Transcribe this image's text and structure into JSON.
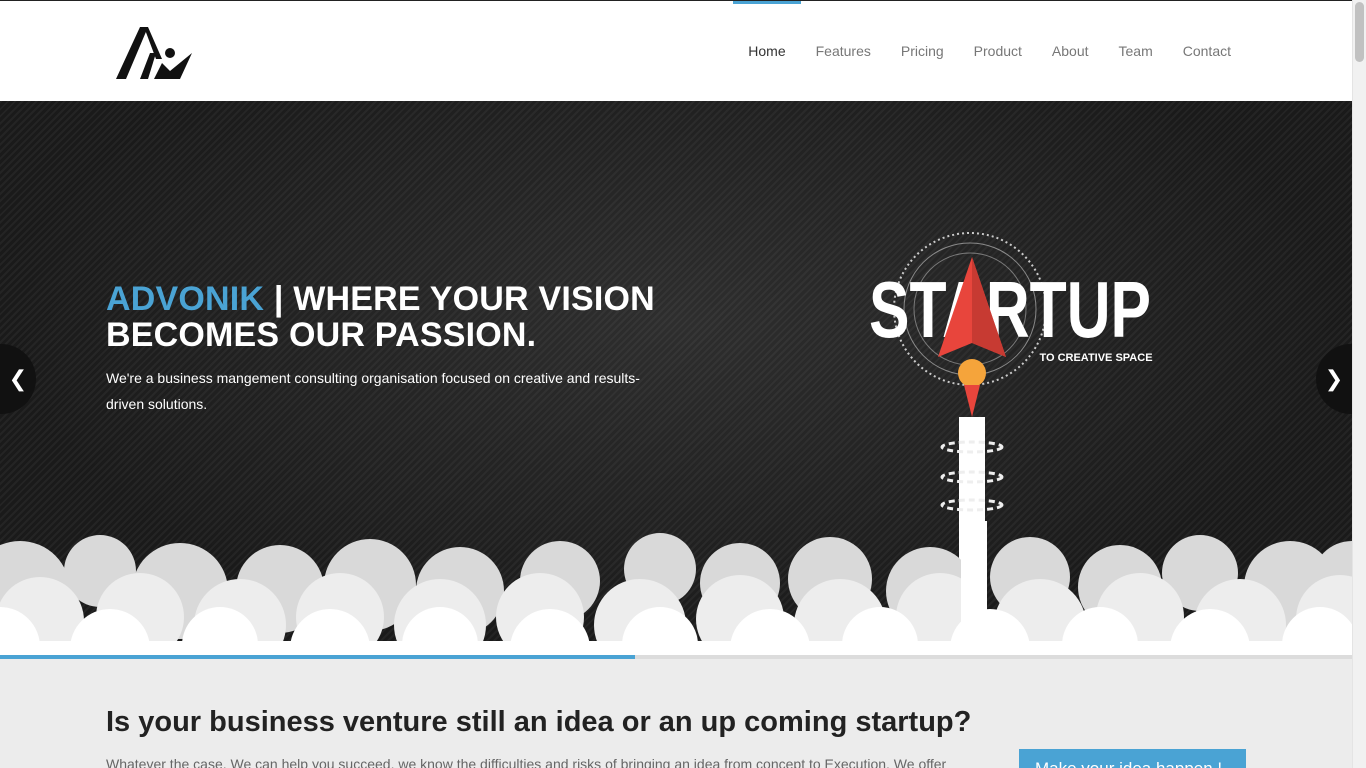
{
  "brand": {
    "logo_icon": "advonik-logo-icon"
  },
  "nav": {
    "items": [
      {
        "label": "Home",
        "active": true
      },
      {
        "label": "Features",
        "active": false
      },
      {
        "label": "Pricing",
        "active": false
      },
      {
        "label": "Product",
        "active": false
      },
      {
        "label": "About",
        "active": false
      },
      {
        "label": "Team",
        "active": false
      },
      {
        "label": "Contact",
        "active": false
      }
    ]
  },
  "hero": {
    "brand_word": "ADVONIK",
    "title_rest": " | WHERE YOUR VISION BECOMES OUR PASSION.",
    "subtitle": "We're a business mangement consulting organisation focused on creative and results-driven solutions.",
    "prev_icon": "chevron-left-icon",
    "next_icon": "chevron-right-icon",
    "graphic": {
      "word": "STARTUP",
      "tagline": "TO CREATIVE SPACE"
    },
    "slide_progress": 0.47
  },
  "intro": {
    "heading": "Is your business venture still an idea or an up coming startup?",
    "text": "Whatever the case, We can help you succeed, we know the difficulties and risks of bringing an idea from concept to Execution. We offer",
    "cta_label": "Make your idea happen !"
  },
  "colors": {
    "accent": "#4aa3d4",
    "hero_bg": "#1c1c1c",
    "rocket": "#e8453c"
  }
}
